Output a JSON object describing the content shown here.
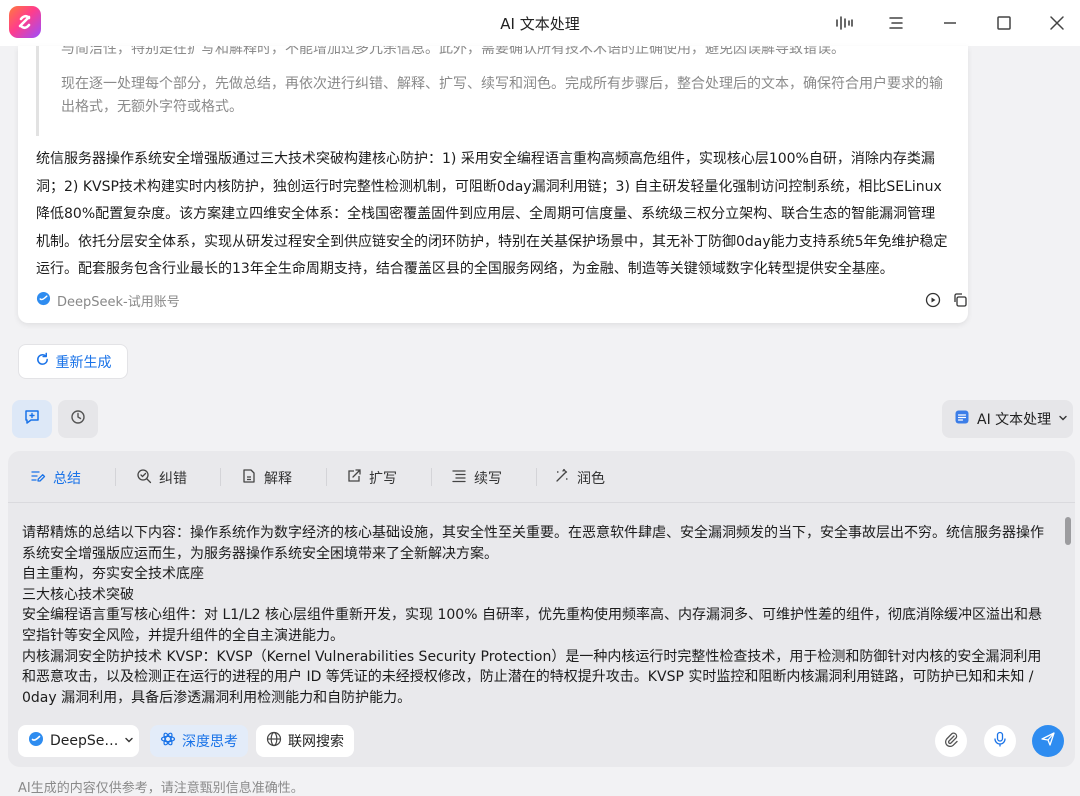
{
  "window": {
    "title": "AI 文本处理"
  },
  "response": {
    "quote_lines": [
      "与简洁性，特别是在扩写和解释时，不能增加过多冗余信息。此外，需要确认所有技术术语的正确使用，避免因误解导致错误。",
      "现在逐一处理每个部分，先做总结，再依次进行纠错、解释、扩写、续写和润色。完成所有步骤后，整合处理后的文本，确保符合用户要求的输出格式，无额外字符或格式。"
    ],
    "answer": "统信服务器操作系统安全增强版通过三大技术突破构建核心防护：1) 采用安全编程语言重构高频高危组件，实现核心层100%自研，消除内存类漏洞；2) KVSP技术构建实时内核防护，独创运行时完整性检测机制，可阻断0day漏洞利用链；3) 自主研发轻量化强制访问控制系统，相比SELinux降低80%配置复杂度。该方案建立四维安全体系：全栈国密覆盖固件到应用层、全周期可信度量、系统级三权分立架构、联合生态的智能漏洞管理机制。依托分层安全体系，实现从研发过程安全到供应链安全的闭环防护，特别在关基保护场景中，其无补丁防御0day能力支持系统5年免维护稳定运行。配套服务包含行业最长的13年全生命周期支持，结合覆盖区县的全国服务网络，为金融、制造等关键领域数字化转型提供安全基座。",
    "model_tag": "DeepSeek-试用账号"
  },
  "actions": {
    "regenerate": "重新生成",
    "mode_select": "AI 文本处理"
  },
  "tabs": [
    {
      "label": "总结",
      "icon": "summary-icon"
    },
    {
      "label": "纠错",
      "icon": "proofread-icon"
    },
    {
      "label": "解释",
      "icon": "explain-icon"
    },
    {
      "label": "扩写",
      "icon": "expand-icon"
    },
    {
      "label": "续写",
      "icon": "continue-icon"
    },
    {
      "label": "润色",
      "icon": "polish-icon"
    }
  ],
  "input": {
    "lines": [
      "请帮精炼的总结以下内容：操作系统作为数字经济的核心基础设施，其安全性至关重要。在恶意软件肆虐、安全漏洞频发的当下，安全事故层出不穷。统信服务器操作系统安全增强版应运而生，为服务器操作系统安全困境带来了全新解决方案。",
      "自主重构，夯实安全技术底座",
      "三大核心技术突破",
      "安全编程语言重写核心组件：对 L1/L2 核心层组件重新开发，实现 100% 自研率，优先重构使用频率高、内存漏洞多、可维护性差的组件，彻底消除缓冲区溢出和悬空指针等安全风险，并提升组件的全自主演进能力。",
      "内核漏洞安全防护技术 KVSP：KVSP（Kernel Vulnerabilities Security Protection）是一种内核运行时完整性检查技术，用于检测和防御针对内核的安全漏洞利用和恶意攻击，以及检测正在运行的进程的用户 ID 等凭证的未经授权修改，防止潜在的特权提升攻击。KVSP 实时监控和阻断内核漏洞利用链路，可防护已知和未知 / 0day 漏洞利用，具备后渗透漏洞利用检测能力和自防护能力。"
    ]
  },
  "bottom": {
    "model_chip": "DeepSe…",
    "deep_think": "深度思考",
    "web_search": "联网搜索"
  },
  "footer": {
    "disclaimer": "AI生成的内容仅供参考，请注意甄别信息准确性。"
  },
  "colors": {
    "accent": "#1a73e8",
    "send": "#2e8cf0"
  }
}
